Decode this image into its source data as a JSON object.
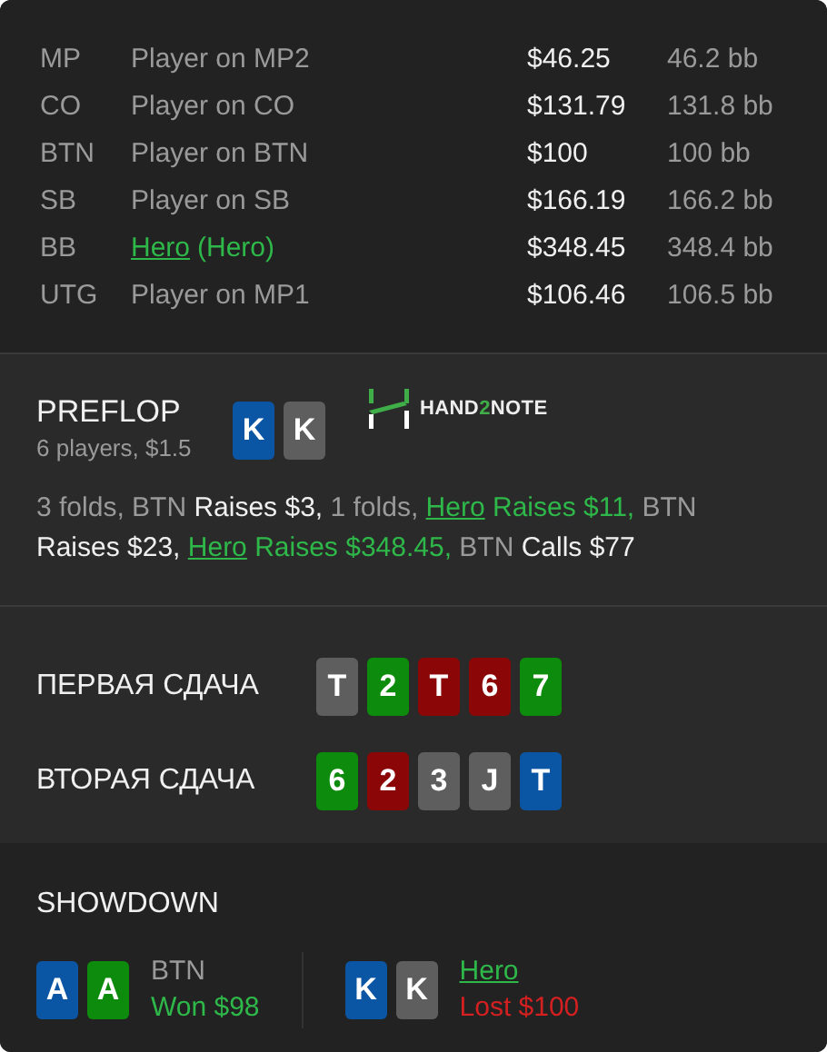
{
  "players": [
    {
      "position": "MP",
      "name": "Player on MP2",
      "is_hero": false,
      "stack": "$46.25",
      "bb": "46.2 bb"
    },
    {
      "position": "CO",
      "name": "Player on CO",
      "is_hero": false,
      "stack": "$131.79",
      "bb": "131.8 bb"
    },
    {
      "position": "BTN",
      "name": "Player on BTN",
      "is_hero": false,
      "stack": "$100",
      "bb": "100 bb"
    },
    {
      "position": "SB",
      "name": "Player on SB",
      "is_hero": false,
      "stack": "$166.19",
      "bb": "166.2 bb"
    },
    {
      "position": "BB",
      "name": "Hero",
      "suffix": "(Hero)",
      "is_hero": true,
      "stack": "$348.45",
      "bb": "348.4 bb"
    },
    {
      "position": "UTG",
      "name": "Player on MP1",
      "is_hero": false,
      "stack": "$106.46",
      "bb": "106.5 bb"
    }
  ],
  "preflop": {
    "title": "PREFLOP",
    "subtitle": "6 players, $1.5",
    "cards": [
      {
        "rank": "K",
        "color": "#0b56a4"
      },
      {
        "rank": "K",
        "color": "#5e5e5e"
      }
    ],
    "logo": {
      "before": "HAND",
      "accent": "2",
      "after": "NOTE"
    },
    "actions": [
      {
        "kind": "muted",
        "text": "3 folds, BTN"
      },
      {
        "kind": "white",
        "text": "Raises $3,"
      },
      {
        "kind": "muted",
        "text": "1 folds,"
      },
      {
        "kind": "hero",
        "text": "Hero"
      },
      {
        "kind": "green",
        "text": "Raises $11,"
      },
      {
        "kind": "muted",
        "text": "BTN"
      },
      {
        "kind": "white",
        "text": "Raises $23,"
      },
      {
        "kind": "hero",
        "text": "Hero"
      },
      {
        "kind": "green",
        "text": "Raises $348.45,"
      },
      {
        "kind": "muted",
        "text": "BTN"
      },
      {
        "kind": "white",
        "text": "Calls $77"
      }
    ]
  },
  "boards": [
    {
      "label": "ПЕРВАЯ СДАЧА",
      "cards": [
        {
          "rank": "T",
          "color": "#5e5e5e"
        },
        {
          "rank": "2",
          "color": "#0d8b0d"
        },
        {
          "rank": "T",
          "color": "#8b0707"
        },
        {
          "rank": "6",
          "color": "#8b0707"
        },
        {
          "rank": "7",
          "color": "#0d8b0d"
        }
      ]
    },
    {
      "label": "ВТОРАЯ СДАЧА",
      "cards": [
        {
          "rank": "6",
          "color": "#0d8b0d"
        },
        {
          "rank": "2",
          "color": "#8b0707"
        },
        {
          "rank": "3",
          "color": "#5e5e5e"
        },
        {
          "rank": "J",
          "color": "#5e5e5e"
        },
        {
          "rank": "T",
          "color": "#0b56a4"
        }
      ]
    }
  ],
  "showdown": {
    "title": "SHOWDOWN",
    "hands": [
      {
        "player": "BTN",
        "is_hero": false,
        "result": "Won $98",
        "won": true,
        "cards": [
          {
            "rank": "A",
            "color": "#0b56a4"
          },
          {
            "rank": "A",
            "color": "#0d8b0d"
          }
        ]
      },
      {
        "player": "Hero",
        "is_hero": true,
        "result": "Lost $100",
        "won": false,
        "cards": [
          {
            "rank": "K",
            "color": "#0b56a4"
          },
          {
            "rank": "K",
            "color": "#5e5e5e"
          }
        ]
      }
    ]
  }
}
